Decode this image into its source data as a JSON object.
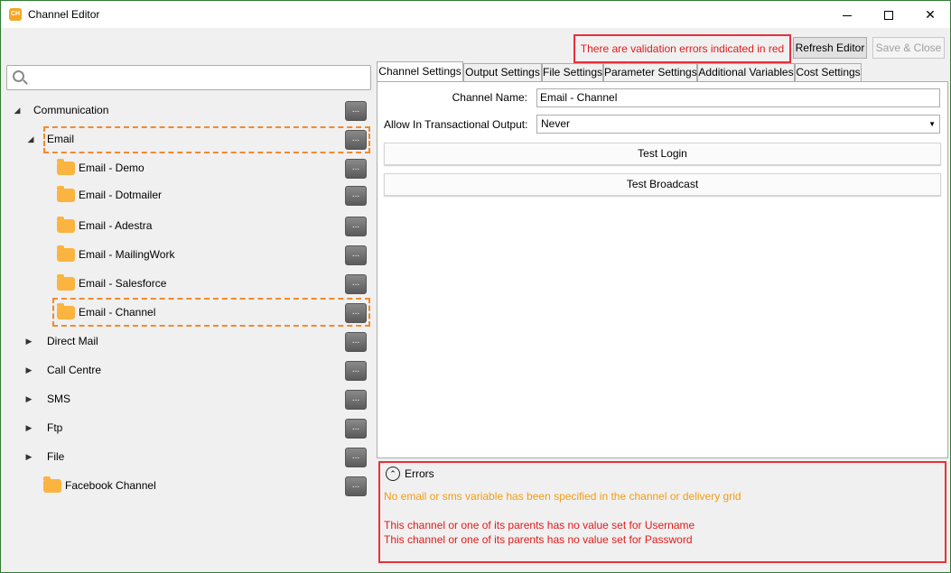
{
  "window": {
    "title": "Channel Editor",
    "app_icon": "channel-icon",
    "app_icon_text": "CH"
  },
  "toolbar": {
    "validation_message": "There are validation errors indicated in red",
    "refresh_label": "Refresh Editor",
    "save_close_label": "Save & Close",
    "save_close_enabled": false
  },
  "search": {
    "value": "",
    "placeholder": ""
  },
  "tree": {
    "communication": "Communication",
    "email": "Email",
    "email_children": [
      "Email - Demo",
      "Email - Dotmailer",
      "Email - Adestra",
      "Email - MailingWork",
      "Email - Salesforce",
      "Email - Channel"
    ],
    "direct_mail": "Direct Mail",
    "call_centre": "Call Centre",
    "sms": "SMS",
    "ftp": "Ftp",
    "file": "File",
    "facebook_channel": "Facebook Channel",
    "node_button_label": "..."
  },
  "tabs": [
    "Channel Settings",
    "Output Settings",
    "File Settings",
    "Parameter Settings",
    "Additional Variables",
    "Cost Settings"
  ],
  "active_tab": "Channel Settings",
  "channel_settings": {
    "channel_name_label": "Channel Name:",
    "channel_name_value": "Email - Channel",
    "transactional_label": "Allow In Transactional Output:",
    "transactional_value": "Never",
    "test_login_label": "Test Login",
    "test_broadcast_label": "Test Broadcast"
  },
  "errors": {
    "title": "Errors",
    "warning": "No email or sms variable has been specified in the channel or delivery grid",
    "messages": [
      "This channel or one of its parents has no value set for Username",
      "This channel or one of its parents has no value set for Password"
    ],
    "warning_color": "#f39c12",
    "error_color": "#e21b1b"
  },
  "colors": {
    "validation_border": "#e8303a",
    "selection_highlight": "#f18a2e",
    "folder": "#fbb440"
  }
}
